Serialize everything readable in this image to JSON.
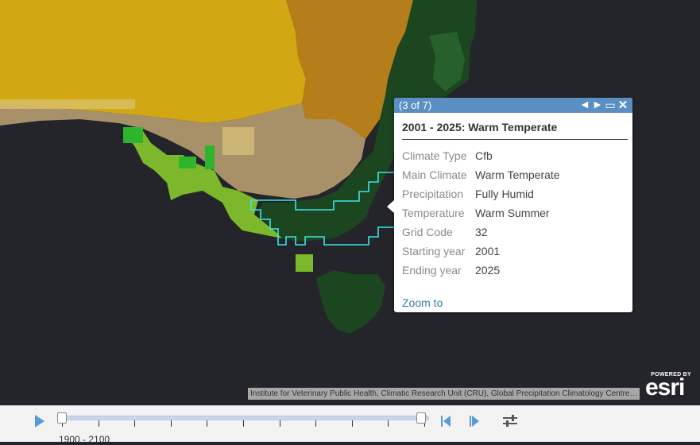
{
  "popup": {
    "counter": "(3 of 7)",
    "title": "2001 - 2025: Warm Temperate",
    "attributes": [
      {
        "key": "Climate Type",
        "value": "Cfb"
      },
      {
        "key": "Main Climate",
        "value": "Warm Temperate"
      },
      {
        "key": "Precipitation",
        "value": "Fully Humid"
      },
      {
        "key": "Temperature",
        "value": "Warm Summer"
      },
      {
        "key": "Grid Code",
        "value": "32"
      },
      {
        "key": "Starting year",
        "value": "2001"
      },
      {
        "key": "Ending year",
        "value": "2025"
      }
    ],
    "zoom_label": "Zoom to",
    "header_color": "#5b8fc4"
  },
  "attribution": "Institute for Veterinary Public Health, Climatic Research Unit (CRU), Global Precipitation Climatology Centre (GPCC)",
  "esri": {
    "powered_by": "POWERED BY",
    "wordmark": "esri"
  },
  "time_slider": {
    "range_label": "1900 - 2100",
    "start_fraction": 0.0,
    "end_fraction": 1.0,
    "tick_count": 11
  },
  "colors": {
    "ocean": "#24252b",
    "arid": "#d1a813",
    "semi_arid": "#b57e1a",
    "steppe": "#a89068",
    "temperate_light": "#7db72b",
    "temperate_dark": "#1b4620",
    "highlight_outline": "#3de3e6",
    "accent": "#5b9bd5"
  }
}
